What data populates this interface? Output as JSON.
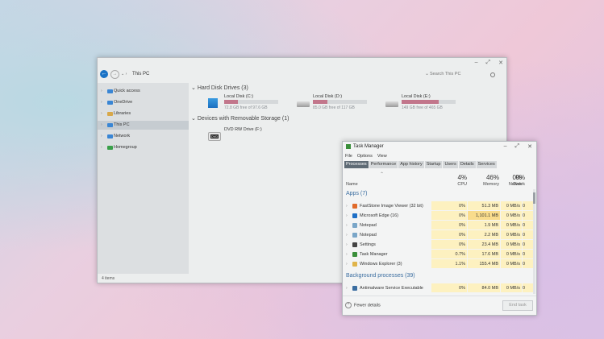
{
  "explorer": {
    "address": "This PC",
    "search_placeholder": "Search This PC",
    "nav_misc": "⌄  ›",
    "status": "4 items",
    "sidebar": [
      {
        "label": "Quick access",
        "icon": "star-icon",
        "color": "#3a86d4",
        "selected": false
      },
      {
        "label": "OneDrive",
        "icon": "cloud-icon",
        "color": "#3a86d4",
        "selected": false
      },
      {
        "label": "Libraries",
        "icon": "library-icon",
        "color": "#d8a84a",
        "selected": false
      },
      {
        "label": "This PC",
        "icon": "computer-icon",
        "color": "#3a86d4",
        "selected": true
      },
      {
        "label": "Network",
        "icon": "network-icon",
        "color": "#3a86d4",
        "selected": false
      },
      {
        "label": "Homegroup",
        "icon": "homegroup-icon",
        "color": "#3aa04a",
        "selected": false
      }
    ],
    "groups": {
      "hard_disks": "Hard Disk Drives (3)",
      "removable": "Devices with Removable Storage (1)"
    },
    "drives": [
      {
        "name": "Local Disk (C:)",
        "free": "72.8 GB free of 97.6 GB",
        "used_fraction": 0.25,
        "color": "#c2768b"
      },
      {
        "name": "Local Disk (D:)",
        "free": "85.0 GB free of 117 GB",
        "used_fraction": 0.27,
        "color": "#c2768b"
      },
      {
        "name": "Local Disk (E:)",
        "free": "149 GB free of 465 GB",
        "used_fraction": 0.68,
        "color": "#c2768b"
      }
    ],
    "dvd": {
      "name": "DVD RW Drive (F:)",
      "badge": "DVD"
    }
  },
  "taskmgr": {
    "title": "Task Manager",
    "menu": [
      "File",
      "Options",
      "View"
    ],
    "tabs": [
      "Processes",
      "Performance",
      "App history",
      "Startup",
      "Users",
      "Details",
      "Services"
    ],
    "columns": {
      "name": "Name",
      "cpu_pct": "4%",
      "cpu": "CPU",
      "mem_pct": "46%",
      "mem": "Memory",
      "disk_pct": "0%",
      "disk": "Disk",
      "net_pct": "0%",
      "net": "Network"
    },
    "apps_header": "Apps (7)",
    "bg_header": "Background processes (39)",
    "apps": [
      {
        "name": "FastStone Image Viewer (32 bit)",
        "cpu": "0%",
        "mem": "51.3 MB",
        "disk": "0 MB/s",
        "net": "0 Mbps",
        "icon": "faststone-icon",
        "color": "#e06a2a"
      },
      {
        "name": "Microsoft Edge (16)",
        "cpu": "0%",
        "mem": "1,101.1 MB",
        "disk": "0 MB/s",
        "net": "0 Mbps",
        "icon": "edge-icon",
        "color": "#1e6fc6"
      },
      {
        "name": "Notepad",
        "cpu": "0%",
        "mem": "1.9 MB",
        "disk": "0 MB/s",
        "net": "0 Mbps",
        "icon": "notepad-icon",
        "color": "#7aa6c8"
      },
      {
        "name": "Notepad",
        "cpu": "0%",
        "mem": "2.2 MB",
        "disk": "0 MB/s",
        "net": "0 Mbps",
        "icon": "notepad-icon",
        "color": "#7aa6c8"
      },
      {
        "name": "Settings",
        "cpu": "0%",
        "mem": "23.4 MB",
        "disk": "0 MB/s",
        "net": "0 Mbps",
        "icon": "settings-icon",
        "color": "#444444"
      },
      {
        "name": "Task Manager",
        "cpu": "0.7%",
        "mem": "17.6 MB",
        "disk": "0 MB/s",
        "net": "0 Mbps",
        "icon": "taskmanager-icon",
        "color": "#3a8f3a"
      },
      {
        "name": "Windows Explorer (3)",
        "cpu": "1.1%",
        "mem": "155.4 MB",
        "disk": "0 MB/s",
        "net": "0 Mbps",
        "icon": "folder-icon",
        "color": "#e0b44a"
      }
    ],
    "bg": [
      {
        "name": "Antimalware Service Executable",
        "cpu": "0%",
        "mem": "84.0 MB",
        "disk": "0 MB/s",
        "net": "0 Mbps",
        "icon": "shield-icon",
        "color": "#3a6da0"
      }
    ],
    "fewer_details": "Fewer details",
    "end_task": "End task"
  }
}
